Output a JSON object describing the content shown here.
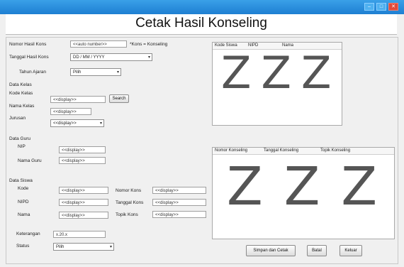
{
  "window": {
    "title": "Cetak Hasil Konseling",
    "controls": [
      "–",
      "□",
      "✕"
    ]
  },
  "header": {
    "kode_label": "Nomor Hasil Kons",
    "kode_value": "<<auto number>>",
    "kode_hint": "*Kons = Konseling",
    "tanggal_label": "Tanggal Hasil Kons",
    "tanggal_value": "DD / MM / YYYY",
    "tahun_label": "Tahun Ajaran",
    "tahun_value": "Pilih"
  },
  "kelas": {
    "section": "Data Kelas",
    "kode_label": "Kode Kelas",
    "kode_value": "<<display>>",
    "search_label": "Search",
    "nama_label": "Nama Kelas",
    "nama_value": "<<display>>",
    "jurusan_label": "Jurusan",
    "jurusan_value": "<<display>>"
  },
  "guru": {
    "section": "Data Guru",
    "nip_label": "NIP",
    "nip_value": "<<display>>",
    "nama_label": "Nama Guru",
    "nama_value": "<<display>>"
  },
  "siswa": {
    "section": "Data Siswa",
    "kode_label": "Kode",
    "kode_value": "<<display>>",
    "nipd_label": "NIPD",
    "nipd_value": "<<display>>",
    "nama_label": "Nama",
    "nama_value": "<<display>>",
    "nomor_kons_label": "Nomor Kons",
    "nomor_kons_value": "<<display>>",
    "tanggal_kons_label": "Tanggal Kons",
    "tanggal_kons_value": "<<display>>",
    "topik_kons_label": "Topik Kons",
    "topik_kons_value": "<<display>>"
  },
  "keterangan": {
    "label": "Keterangan",
    "value": "x.20.x"
  },
  "status": {
    "label": "Status",
    "value": "Pilih"
  },
  "table_top": {
    "columns": [
      "Kode Siswa",
      "NIPD",
      "Nama"
    ],
    "placeholder": "Z"
  },
  "table_bottom": {
    "columns": [
      "Nomor Konseling",
      "Tanggal Konseling",
      "Topik Konseling"
    ],
    "placeholder": "Z"
  },
  "buttons": {
    "save_print": "Simpan dan Cetak",
    "clear": "Batal",
    "exit": "Keluar"
  }
}
